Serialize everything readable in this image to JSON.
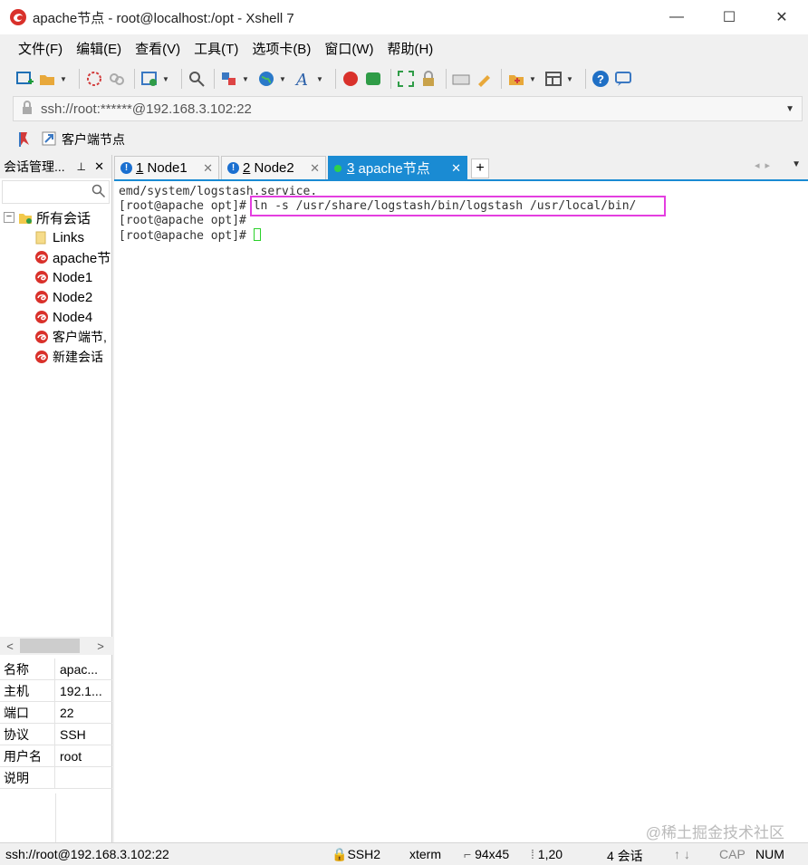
{
  "window": {
    "title": "apache节点 - root@localhost:/opt - Xshell 7",
    "minimize": "—",
    "maximize": "☐",
    "close": "✕"
  },
  "menu": [
    "文件(F)",
    "编辑(E)",
    "查看(V)",
    "工具(T)",
    "选项卡(B)",
    "窗口(W)",
    "帮助(H)"
  ],
  "address": {
    "value": "ssh://root:******@192.168.3.102:22"
  },
  "links": {
    "label": "客户端节点"
  },
  "session_panel": {
    "title": "会话管理...",
    "tree": {
      "root": "所有会话",
      "children": [
        "Links",
        "apache节",
        "Node1",
        "Node2",
        "Node4",
        "客户端节,",
        "新建会话"
      ]
    },
    "properties": [
      {
        "key": "名称",
        "value": "apac..."
      },
      {
        "key": "主机",
        "value": "192.1..."
      },
      {
        "key": "端口",
        "value": "22"
      },
      {
        "key": "协议",
        "value": "SSH"
      },
      {
        "key": "用户名",
        "value": "root"
      },
      {
        "key": "说明",
        "value": ""
      }
    ]
  },
  "tabs": [
    {
      "number": "1",
      "label": "Node1"
    },
    {
      "number": "2",
      "label": "Node2"
    },
    {
      "number": "3",
      "label": "apache节点"
    }
  ],
  "terminal": {
    "line1": "emd/system/logstash.service.",
    "line2_prompt": "[root@apache opt]#",
    "line2_cmd": " ln -s /usr/share/logstash/bin/logstash /usr/local/bin/",
    "line3": "[root@apache opt]#",
    "line4_prompt": "[root@apache opt]# "
  },
  "watermark": "@稀土掘金技术社区",
  "status": {
    "connection": "ssh://root@192.168.3.102:22",
    "protocol": "SSH2",
    "term": "xterm",
    "size": "94x45",
    "position": "1,20",
    "sessions": "4 会话",
    "cap": "CAP",
    "num": "NUM"
  },
  "colors": {
    "accent": "#1a8bd3",
    "highlight": "#e43ee0",
    "cursor": "#2bd12b"
  }
}
